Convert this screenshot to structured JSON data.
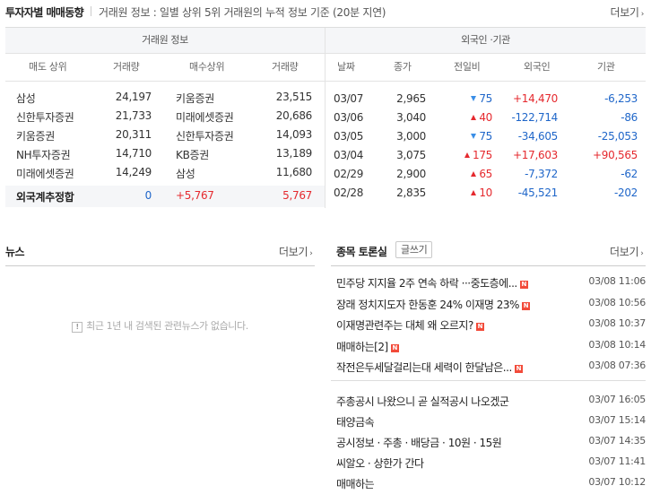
{
  "header": {
    "title": "투자자별 매매동향",
    "desc": "거래원 정보 : 일별 상위 5위 거래원의 누적 정보 기준 (20분 지연)",
    "more": "더보기"
  },
  "broker": {
    "group": "거래원 정보",
    "col_sell": "매도 상위",
    "col_sell_vol": "거래량",
    "col_buy": "매수상위",
    "col_buy_vol": "거래량",
    "rows": [
      {
        "sell": "삼성",
        "sell_vol": "24,197",
        "buy": "키움증권",
        "buy_vol": "23,515"
      },
      {
        "sell": "신한투자증권",
        "sell_vol": "21,733",
        "buy": "미래에셋증권",
        "buy_vol": "20,686"
      },
      {
        "sell": "키움증권",
        "sell_vol": "20,311",
        "buy": "신한투자증권",
        "buy_vol": "14,093"
      },
      {
        "sell": "NH투자증권",
        "sell_vol": "14,710",
        "buy": "KB증권",
        "buy_vol": "13,189"
      },
      {
        "sell": "미래에셋증권",
        "sell_vol": "14,249",
        "buy": "삼성",
        "buy_vol": "11,680"
      }
    ],
    "foreign": {
      "label": "외국계추정합",
      "sell_vol": "0",
      "net": "+5,767",
      "buy_vol": "5,767"
    }
  },
  "inst": {
    "group": "외국인 ·기관",
    "col_date": "날짜",
    "col_close": "종가",
    "col_change": "전일비",
    "col_foreign": "외국인",
    "col_inst": "기관",
    "rows": [
      {
        "date": "03/07",
        "close": "2,965",
        "dir": "down",
        "change": "75",
        "foreign": "+14,470",
        "inst": "-6,253"
      },
      {
        "date": "03/06",
        "close": "3,040",
        "dir": "up",
        "change": "40",
        "foreign": "-122,714",
        "inst": "-86"
      },
      {
        "date": "03/05",
        "close": "3,000",
        "dir": "down",
        "change": "75",
        "foreign": "-34,605",
        "inst": "-25,053"
      },
      {
        "date": "03/04",
        "close": "3,075",
        "dir": "up",
        "change": "175",
        "foreign": "+17,603",
        "inst": "+90,565"
      },
      {
        "date": "02/29",
        "close": "2,900",
        "dir": "up",
        "change": "65",
        "foreign": "-7,372",
        "inst": "-62"
      },
      {
        "date": "02/28",
        "close": "2,835",
        "dir": "up",
        "change": "10",
        "foreign": "-45,521",
        "inst": "-202"
      }
    ]
  },
  "news": {
    "title": "뉴스",
    "more": "더보기",
    "empty": "최근 1년 내 검색된 관련뉴스가 없습니다."
  },
  "board": {
    "title": "종목 토론실",
    "write": "글쓰기",
    "more": "더보기",
    "posts_new": [
      {
        "text": "민주당 지지율 2주 연속 하락 ···중도층에...",
        "date": "03/08 11:06"
      },
      {
        "text": "장래 정치지도자 한동훈 24% 이재명 23%",
        "date": "03/08 10:56"
      },
      {
        "text": "이재명관련주는 대체 왜 오르지?",
        "date": "03/08 10:37"
      },
      {
        "text": "매매하는[2]",
        "date": "03/08 10:14"
      },
      {
        "text": "작전은두세달걸리는대 세력이 한달남은...",
        "date": "03/08 07:36"
      }
    ],
    "posts_old": [
      {
        "text": "주총공시 나왔으니 곧 실적공시 나오겠군",
        "date": "03/07 16:05"
      },
      {
        "text": "태양금속",
        "date": "03/07 15:14"
      },
      {
        "text": "공시정보 · 주총 · 배당금 · 10원 · 15원",
        "date": "03/07 14:35"
      },
      {
        "text": "씨알오 · 상한가 간다",
        "date": "03/07 11:41"
      },
      {
        "text": "매매하는",
        "date": "03/07 10:12"
      }
    ],
    "new_badge": "N"
  }
}
